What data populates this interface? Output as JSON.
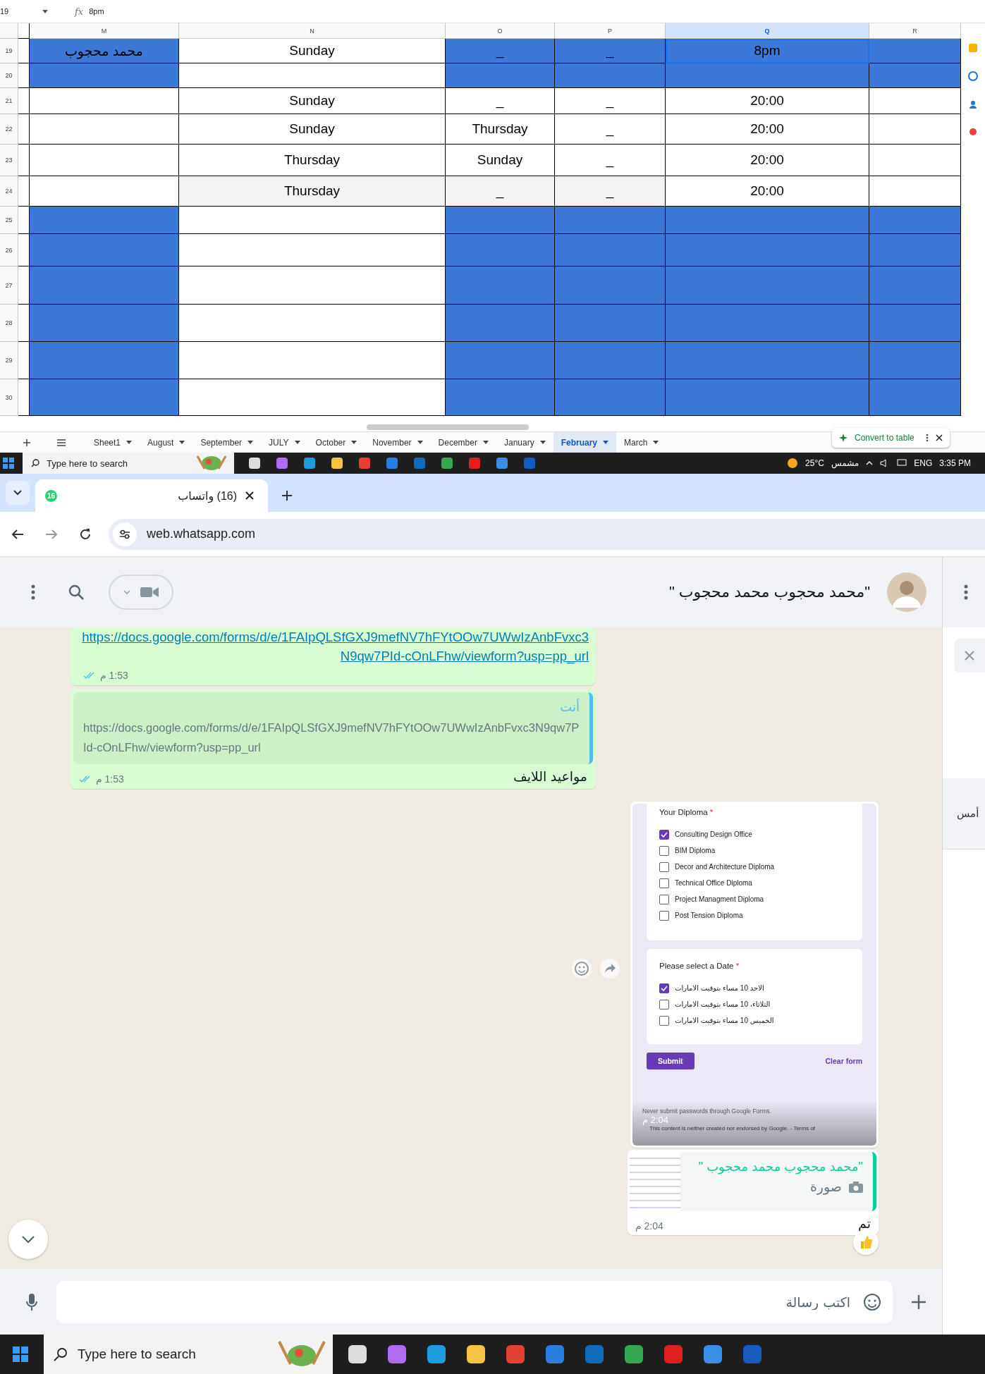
{
  "sheet": {
    "name_box": "19",
    "formula_icon": "fx",
    "formula": "8pm",
    "columns": [
      {
        "label": "M",
        "selected": false
      },
      {
        "label": "N",
        "selected": false
      },
      {
        "label": "O",
        "selected": false
      },
      {
        "label": "P",
        "selected": false
      },
      {
        "label": "Q",
        "selected": true
      },
      {
        "label": "R",
        "selected": false
      }
    ],
    "rows": [
      {
        "number": "19",
        "cells": [
          {
            "text": "محمد محجوب",
            "color": "#3c78d8",
            "selected": false
          },
          {
            "text": "Sunday",
            "color": "#ffffff",
            "selected": false
          },
          {
            "text": "_",
            "color": "#3c78d8",
            "selected": false
          },
          {
            "text": "_",
            "color": "#3c78d8",
            "selected": false
          },
          {
            "text": "8pm",
            "color": "#3c78d8",
            "selected": true
          },
          {
            "color": "#3c78d8",
            "selected": false
          }
        ]
      },
      {
        "number": "20",
        "cells": [
          {
            "color": "#3c78d8",
            "selected": false
          },
          {
            "color": "#ffffff",
            "selected": false
          },
          {
            "color": "#3c78d8",
            "selected": false
          },
          {
            "color": "#3c78d8",
            "selected": false
          },
          {
            "color": "#3c78d8",
            "selected": false
          },
          {
            "color": "#3c78d8",
            "selected": false
          }
        ]
      },
      {
        "number": "21",
        "cells": [
          {
            "color": "#ffffff",
            "selected": false
          },
          {
            "text": "Sunday",
            "color": "#ffffff",
            "selected": false
          },
          {
            "text": "_",
            "color": "#ffffff",
            "selected": false
          },
          {
            "text": "_",
            "color": "#ffffff",
            "selected": false
          },
          {
            "text": "20:00",
            "color": "#ffffff",
            "selected": false
          },
          {
            "color": "#ffffff",
            "selected": false
          }
        ]
      },
      {
        "number": "22",
        "cells": [
          {
            "color": "#ffffff",
            "selected": false
          },
          {
            "text": "Sunday",
            "color": "#ffffff",
            "selected": false
          },
          {
            "text": "Thursday",
            "color": "#ffffff",
            "selected": false
          },
          {
            "text": "_",
            "color": "#ffffff",
            "selected": false
          },
          {
            "text": "20:00",
            "color": "#ffffff",
            "selected": false
          },
          {
            "color": "#ffffff",
            "selected": false
          }
        ]
      },
      {
        "number": "23",
        "cells": [
          {
            "color": "#ffffff",
            "selected": false
          },
          {
            "text": "Thursday",
            "color": "#ffffff",
            "selected": false
          },
          {
            "text": "Sunday",
            "color": "#ffffff",
            "selected": false
          },
          {
            "text": "_",
            "color": "#ffffff",
            "selected": false
          },
          {
            "text": "20:00",
            "color": "#ffffff",
            "selected": false
          },
          {
            "color": "#ffffff",
            "selected": false
          }
        ]
      },
      {
        "number": "24",
        "cells": [
          {
            "color": "#ffffff",
            "selected": false
          },
          {
            "text": "Thursday",
            "color": "#f3f3f3",
            "selected": false
          },
          {
            "text": "_",
            "color": "#f3f3f3",
            "selected": false
          },
          {
            "text": "_",
            "color": "#f3f3f3",
            "selected": false
          },
          {
            "text": "20:00",
            "color": "#ffffff",
            "selected": false
          },
          {
            "color": "#ffffff",
            "selected": false
          }
        ]
      },
      {
        "number": "25",
        "cells": [
          {
            "color": "#3c78d8",
            "selected": false
          },
          {
            "color": "#ffffff",
            "selected": false
          },
          {
            "color": "#3c78d8",
            "selected": false
          },
          {
            "color": "#3c78d8",
            "selected": false
          },
          {
            "color": "#3c78d8",
            "selected": false
          },
          {
            "color": "#3c78d8",
            "selected": false
          }
        ]
      },
      {
        "number": "26",
        "cells": [
          {
            "color": "#3c78d8",
            "selected": false
          },
          {
            "color": "#ffffff",
            "selected": false
          },
          {
            "color": "#3c78d8",
            "selected": false
          },
          {
            "color": "#3c78d8",
            "selected": false
          },
          {
            "color": "#3c78d8",
            "selected": false
          },
          {
            "color": "#3c78d8",
            "selected": false
          }
        ]
      },
      {
        "number": "27",
        "cells": [
          {
            "color": "#3c78d8",
            "selected": false
          },
          {
            "color": "#ffffff",
            "selected": false
          },
          {
            "color": "#3c78d8",
            "selected": false
          },
          {
            "color": "#3c78d8",
            "selected": false
          },
          {
            "color": "#3c78d8",
            "selected": false
          },
          {
            "color": "#3c78d8",
            "selected": false
          }
        ]
      },
      {
        "number": "28",
        "cells": [
          {
            "color": "#3c78d8",
            "selected": false
          },
          {
            "color": "#ffffff",
            "selected": false
          },
          {
            "color": "#3c78d8",
            "selected": false
          },
          {
            "color": "#3c78d8",
            "selected": false
          },
          {
            "color": "#3c78d8",
            "selected": false
          },
          {
            "color": "#3c78d8",
            "selected": false
          }
        ]
      },
      {
        "number": "29",
        "cells": [
          {
            "color": "#3c78d8",
            "selected": false
          },
          {
            "color": "#ffffff",
            "selected": false
          },
          {
            "color": "#3c78d8",
            "selected": false
          },
          {
            "color": "#3c78d8",
            "selected": false
          },
          {
            "color": "#3c78d8",
            "selected": false
          },
          {
            "color": "#3c78d8",
            "selected": false
          }
        ]
      },
      {
        "number": "30",
        "cells": [
          {
            "color": "#3c78d8",
            "selected": false
          },
          {
            "color": "#ffffff",
            "selected": false
          },
          {
            "color": "#3c78d8",
            "selected": false
          },
          {
            "color": "#3c78d8",
            "selected": false
          },
          {
            "color": "#3c78d8",
            "selected": false
          },
          {
            "color": "#3c78d8",
            "selected": false
          }
        ]
      }
    ],
    "convert_chip": "Convert to table",
    "sheet_tabs": [
      {
        "label": "Sheet1",
        "selected": false
      },
      {
        "label": "August",
        "selected": false
      },
      {
        "label": "September",
        "selected": false
      },
      {
        "label": "JULY",
        "selected": false
      },
      {
        "label": "October",
        "selected": false
      },
      {
        "label": "November",
        "selected": false
      },
      {
        "label": "December",
        "selected": false
      },
      {
        "label": "January",
        "selected": false
      },
      {
        "label": "February",
        "selected": true
      },
      {
        "label": "March",
        "selected": false
      }
    ]
  },
  "top_taskbar": {
    "search_placeholder": "Type here to search",
    "temperature": "25°C",
    "weather": "مشمس",
    "language": "ENG",
    "time": "3:35 PM"
  },
  "browser": {
    "tab_badge": "16",
    "tab_title": "(16) واتساب",
    "url": "web.whatsapp.com"
  },
  "whatsapp": {
    "contact": "\"محمد محجوب محمد محجوب \"",
    "messages": [
      {
        "kind": "link",
        "outgoing": true,
        "link": "https://docs.google.com/forms/d/e/1FAIpQLSfGXJ9mefNV7hFYtOOw7UWwIzAnbFvxc3N9qw7PId-cOnLFhw/viewform?usp=pp_url",
        "time": "1:53 م",
        "read": true
      },
      {
        "kind": "reply",
        "outgoing": true,
        "quote": {
          "kind": "text",
          "author": "أنت",
          "color": "#53bdeb",
          "text": "https://docs.google.com/forms/d/e/1FAIpQLSfGXJ9mefNV7hFYtOOw7UWwIzAnbFvxc3N9qw7PId-cOnLFhw/viewform?usp=pp_url"
        },
        "text": "مواعيد اللايف",
        "time": "1:53 م",
        "read": true
      },
      {
        "kind": "image",
        "outgoing": false,
        "time": "2:04 م",
        "form": {
          "sections": [
            {
              "title": "Your Diploma",
              "mark": "*",
              "options": [
                {
                  "label": "Consulting Design Office",
                  "checked": true
                },
                {
                  "label": "BIM Diploma",
                  "checked": false
                },
                {
                  "label": "Decor and Architecture Diploma",
                  "checked": false
                },
                {
                  "label": "Technical Office Diploma",
                  "checked": false
                },
                {
                  "label": "Project Managment Diploma",
                  "checked": false
                },
                {
                  "label": "Post Tension Diploma",
                  "checked": false
                }
              ]
            },
            {
              "title": "Please select a Date",
              "mark": "*",
              "options": [
                {
                  "label": "الاحد 10 مساء بتوقيت الامارات",
                  "checked": true
                },
                {
                  "label": "الثلاثاء، 10 مساء بتوقيت الامارات",
                  "checked": false
                },
                {
                  "label": "الخميس 10 مساء بتوقيت الامارات",
                  "checked": false
                }
              ]
            }
          ],
          "submit": "Submit",
          "clear": "Clear form",
          "notice": "Never submit passwords through Google Forms.",
          "footer": "This content is neither created nor endorsed by Google. - Terms of"
        }
      },
      {
        "kind": "reply",
        "outgoing": false,
        "quote": {
          "kind": "photo",
          "author": "\"محمد محجوب محمد محجوب \"",
          "color": "#06cf9c",
          "text": "صورة"
        },
        "text": "تم",
        "time": "2:04 م"
      }
    ],
    "composer_placeholder": "اكتب رسالة",
    "side_panel_day": "أمس"
  },
  "bottom_taskbar": {
    "search_placeholder": "Type here to search"
  }
}
